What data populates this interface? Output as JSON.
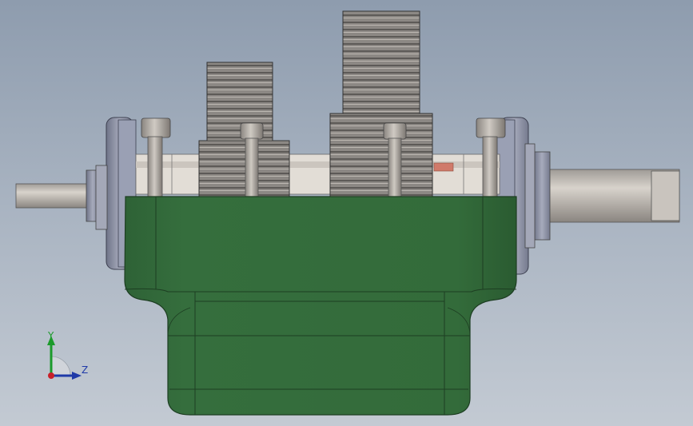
{
  "triad": {
    "y_label": "Y",
    "z_label": "Z",
    "colors": {
      "y": "#1b9a2b",
      "z": "#1f3aa8",
      "origin": "#c8202a"
    }
  },
  "model": {
    "colors": {
      "housing": "#336b3a",
      "housing_edge": "#1d3e22",
      "shaft": "#bfb9b2",
      "gear": "#888480",
      "flange": "#8d92a8",
      "accent": "#d07a6a"
    }
  }
}
